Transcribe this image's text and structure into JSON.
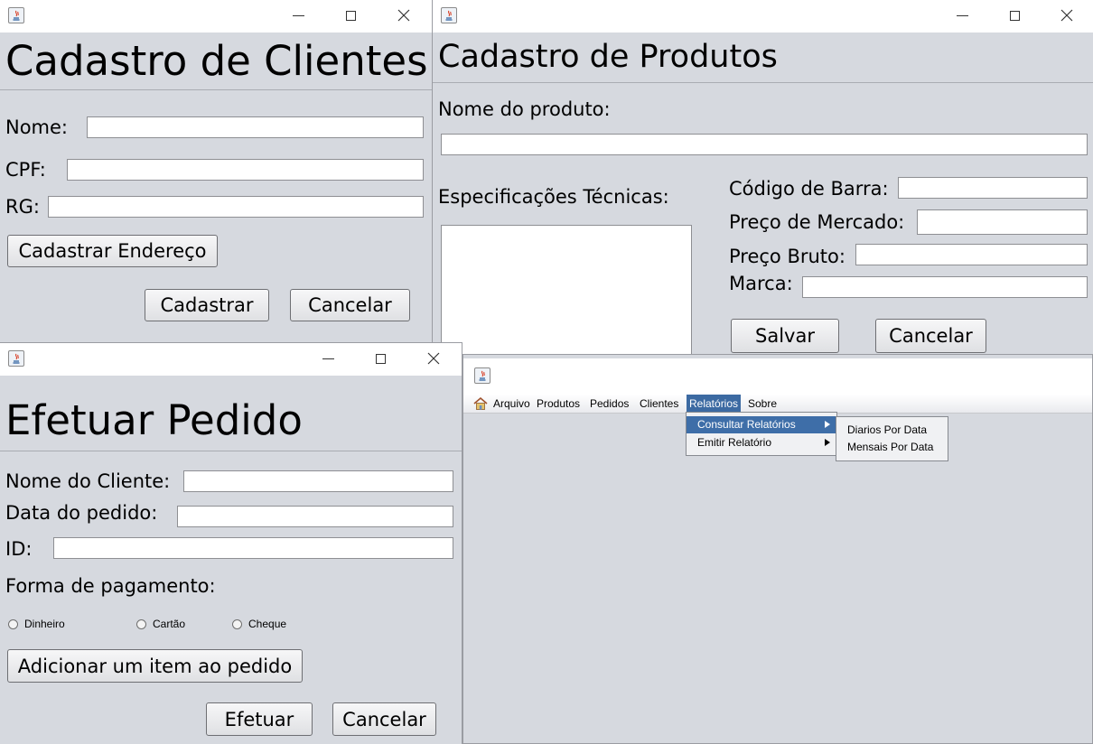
{
  "clientes": {
    "title": "Cadastro de Clientes",
    "nome_label": "Nome:",
    "cpf_label": "CPF:",
    "rg_label": "RG:",
    "nome_value": "",
    "cpf_value": "",
    "rg_value": "",
    "endereco_button": "Cadastrar Endereço",
    "cadastrar_button": "Cadastrar",
    "cancelar_button": "Cancelar"
  },
  "produtos": {
    "title": "Cadastro de Produtos",
    "nome_label": "Nome do produto:",
    "nome_value": "",
    "especificacoes_label": "Especificações Técnicas:",
    "especificacoes_value": "",
    "codigo_label": "Código de Barra:",
    "preco_mercado_label": "Preço de Mercado:",
    "preco_bruto_label": "Preço Bruto:",
    "marca_label": "Marca:",
    "codigo_value": "",
    "preco_mercado_value": "",
    "preco_bruto_value": "",
    "marca_value": "",
    "salvar_button": "Salvar",
    "cancelar_button": "Cancelar"
  },
  "pedido": {
    "title": "Efetuar Pedido",
    "cliente_label": "Nome do Cliente:",
    "data_label": "Data do pedido:",
    "id_label": "ID:",
    "cliente_value": "",
    "data_value": "",
    "id_value": "",
    "pagamento_label": "Forma de pagamento:",
    "payment_options": [
      "Dinheiro",
      "Cartão",
      "Cheque"
    ],
    "adicionar_button": "Adicionar um item ao pedido",
    "efetuar_button": "Efetuar",
    "cancelar_button": "Cancelar"
  },
  "main": {
    "menu": [
      "Arquivo",
      "Produtos",
      "Pedidos",
      "Clientes",
      "Relatórios",
      "Sobre"
    ],
    "active_menu": "Relatórios",
    "menu_icon": "home-icon",
    "relatorios_items": [
      "Consultar Relatórios",
      "Emitir Relatório"
    ],
    "consultar_items": [
      "Diarios Por Data",
      "Mensais Por Data"
    ]
  },
  "colors": {
    "selection": "#3e6ea8",
    "window_bg": "#d6d9df",
    "titlebar_bg": "#ffffff"
  }
}
